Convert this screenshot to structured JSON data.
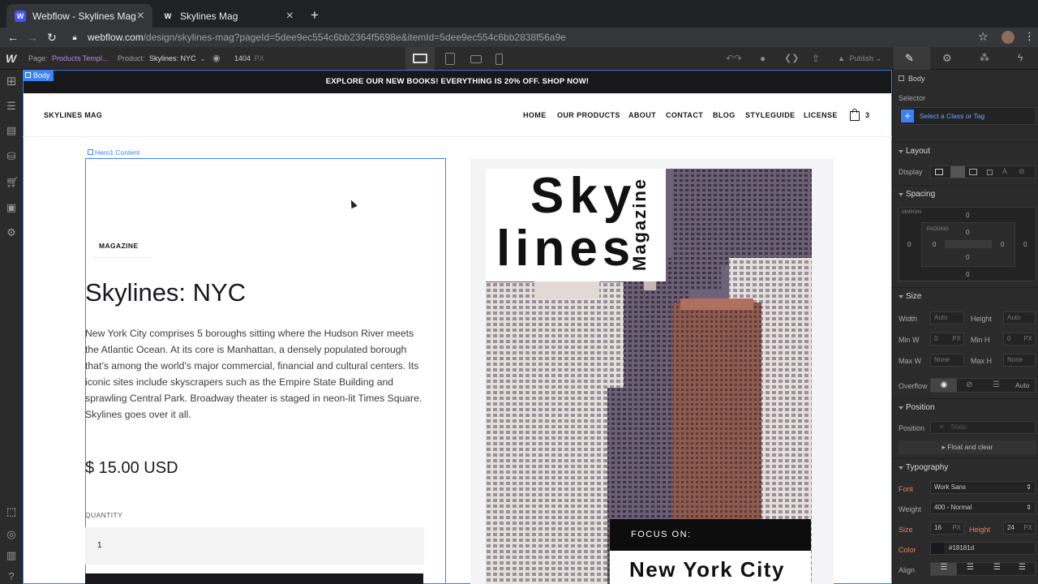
{
  "browser": {
    "tabs": [
      {
        "title": "Webflow - Skylines Mag",
        "favicon": "W"
      },
      {
        "title": "Skylines Mag",
        "favicon": "W"
      }
    ],
    "url_host": "webflow.com",
    "url_path": "/design/skylines-mag?pageId=5dee9ec554c6bb2364f5698e&itemId=5dee9ec554c6bb2838f56a9e"
  },
  "topbar": {
    "page_label": "Page:",
    "page_value": "Products Templ...",
    "product_label": "Product:",
    "product_value": "Skylines: NYC",
    "width_value": "1404",
    "width_unit": "PX",
    "publish_label": "Publish"
  },
  "canvas": {
    "body_badge": "Body",
    "banner": "EXPLORE OUR NEW BOOKS! EVERYTHING IS 20% OFF. SHOP NOW!",
    "site_name": "SKYLINES MAG",
    "nav": [
      "HOME",
      "OUR PRODUCTS",
      "ABOUT",
      "CONTACT",
      "BLOG",
      "STYLEGUIDE",
      "LICENSE"
    ],
    "cart_count": "3",
    "hero_label": "Hero1 Content",
    "category": "MAGAZINE",
    "product_title": "Skylines: NYC",
    "description": "New York City comprises 5 boroughs sitting where the Hudson River meets the Atlantic Ocean. At its core is Manhattan, a densely populated borough that’s among the world’s major commercial, financial and cultural centers. Its iconic sites include skyscrapers such as the Empire State Building and sprawling Central Park. Broadway theater is staged in neon-lit Times Square. Skylines goes over it all.",
    "price": "$ 15.00 USD",
    "quantity_label": "QUANTITY",
    "quantity_value": "1",
    "cover_line1": "Sky",
    "cover_line2": "lines",
    "cover_vertical": "Magazine",
    "cover_focus": "FOCUS ON:",
    "cover_city": "New York City"
  },
  "panel": {
    "element_name": "Body",
    "selector_label": "Selector",
    "selector_placeholder": "Select a Class or Tag",
    "layout_title": "Layout",
    "display_label": "Display",
    "spacing_title": "Spacing",
    "margin_label": "MARGIN",
    "padding_label": "PADDING",
    "zero": "0",
    "size_title": "Size",
    "width_label": "Width",
    "height_label": "Height",
    "auto": "Auto",
    "minw_label": "Min W",
    "minh_label": "Min H",
    "maxw_label": "Max W",
    "maxh_label": "Max H",
    "none": "None",
    "px": "PX",
    "overflow_label": "Overflow",
    "overflow_auto": "Auto",
    "position_title": "Position",
    "position_label": "Position",
    "position_value": "Static",
    "float_clear": "Float and clear",
    "typography_title": "Typography",
    "font_label": "Font",
    "font_value": "Work Sans",
    "weight_label": "Weight",
    "weight_value": "400 - Normal",
    "size_label": "Size",
    "size_value": "16",
    "lh_label": "Height",
    "lh_value": "24",
    "color_label": "Color",
    "color_value": "#18181d",
    "align_label": "Align"
  },
  "colors": {
    "accent": "#3d82f4",
    "banner_bg": "#18181a",
    "panel_bg": "#2b2b2b",
    "text_dark": "#18181d",
    "orange_label": "#e27f62"
  }
}
